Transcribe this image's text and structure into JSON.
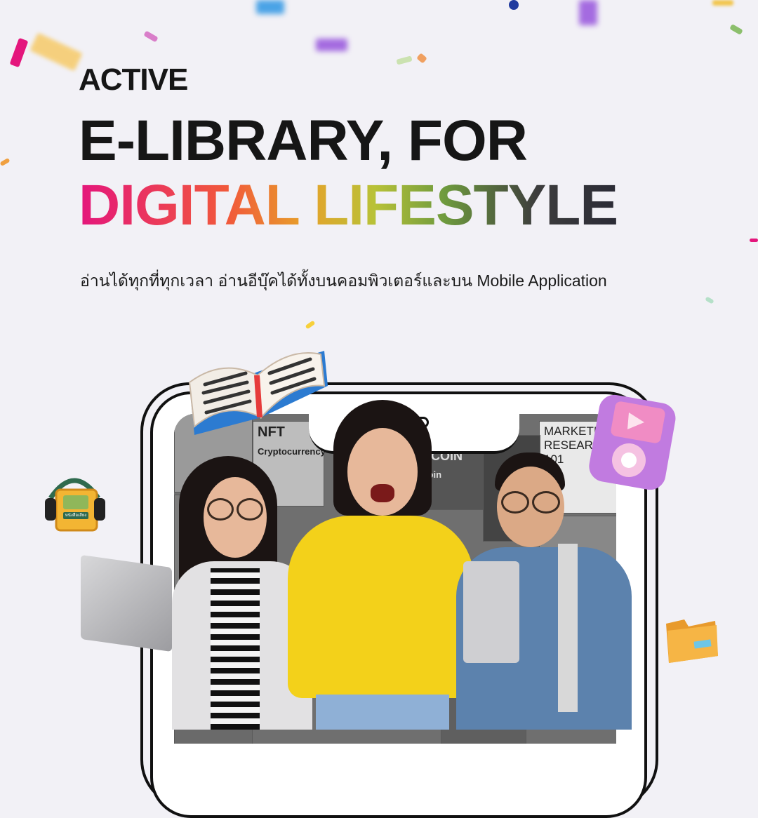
{
  "hero": {
    "line1": "ACTIVE",
    "line2": "E-LIBRARY, FOR",
    "line3": "DIGITAL LIFESTYLE",
    "subtitle": "อ่านได้ทุกที่ทุกเวลา อ่านอีบุ๊คได้ทั้งบนคอมพิวเตอร์และบน Mobile Application"
  },
  "screen_books": [
    {
      "title": "NFT"
    },
    {
      "title": "Cryptocurrency"
    },
    {
      "title": "BITCOIN"
    },
    {
      "title": "Bitcoin"
    },
    {
      "title": "MARKETING RESEARCH 101"
    }
  ],
  "audiobook_badge": "หนังสือเสียง",
  "colors": {
    "headline": "#161616",
    "gradient_start": "#e4167c",
    "gradient_mid": "#b8c238",
    "gradient_end": "#2b2b36",
    "background": "#f2f1f6"
  },
  "icons": [
    "open-book-icon",
    "audiobook-headphones-icon",
    "media-player-icon",
    "folder-icon"
  ]
}
